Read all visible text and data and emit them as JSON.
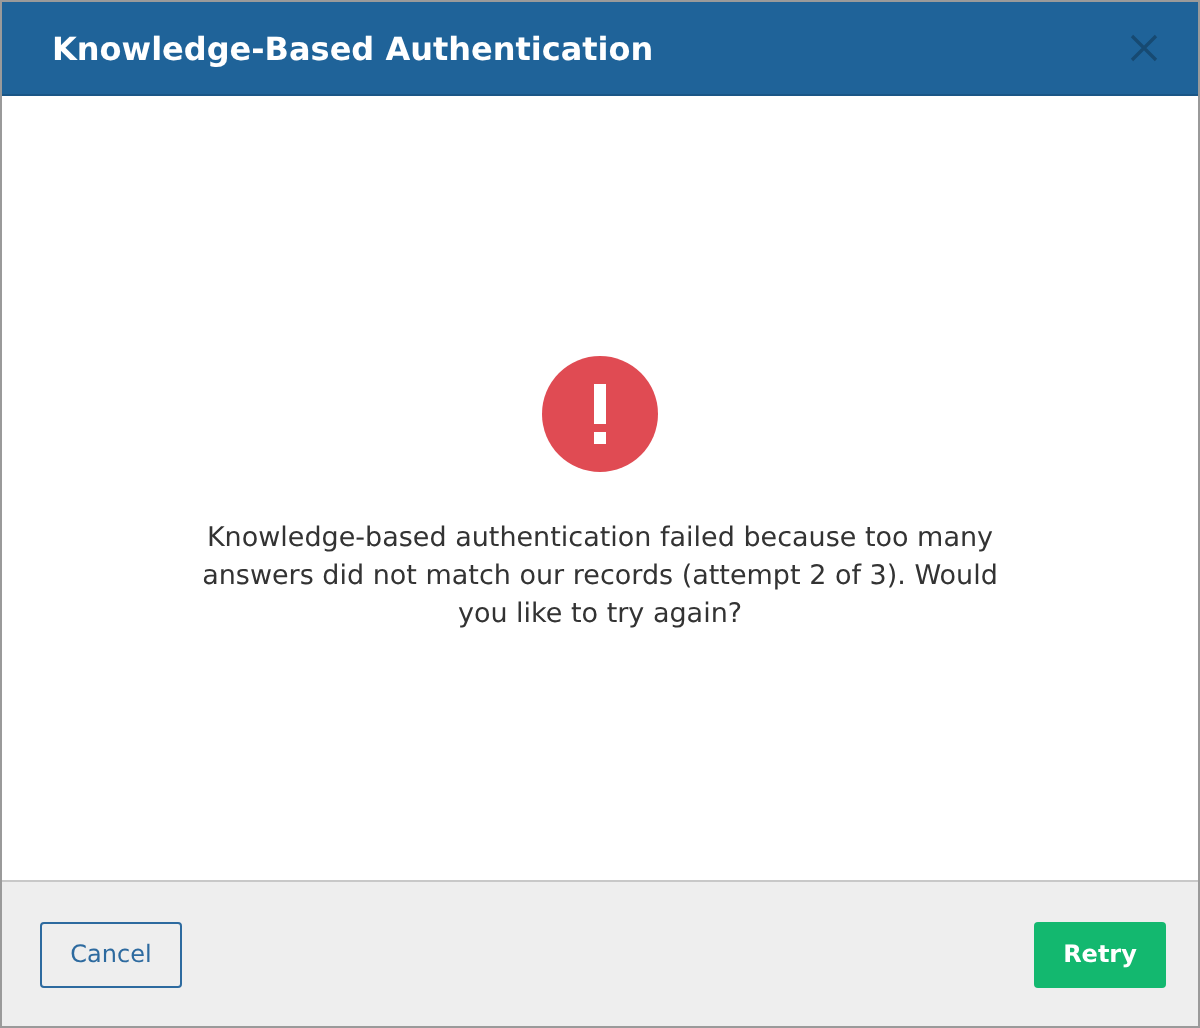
{
  "window": {
    "title": "Knowledge-Based Authentication"
  },
  "message": "Knowledge-based authentication failed because too many answers did not match our records (attempt 2 of 3). Would you like to try again?",
  "buttons": [
    {
      "label": "Cancel",
      "kind": "secondary"
    },
    {
      "label": "Retry",
      "kind": "primary"
    }
  ]
}
